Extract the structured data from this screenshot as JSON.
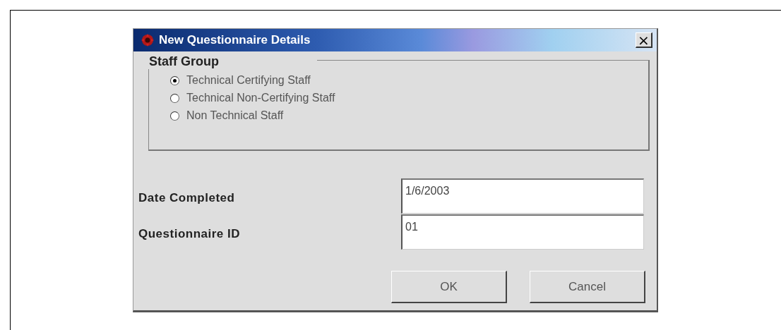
{
  "window": {
    "title": "New Questionnaire Details",
    "close": "×"
  },
  "staff_group": {
    "title": "Staff Group",
    "options": [
      {
        "label": "Technical Certifying Staff",
        "selected": true
      },
      {
        "label": "Technical Non-Certifying Staff",
        "selected": false
      },
      {
        "label": "Non Technical Staff",
        "selected": false
      }
    ]
  },
  "fields": [
    {
      "label": "Date Completed",
      "value": "1/6/2003"
    },
    {
      "label": "Questionnaire ID",
      "value": "01"
    }
  ],
  "buttons": [
    "OK",
    "Cancel"
  ]
}
